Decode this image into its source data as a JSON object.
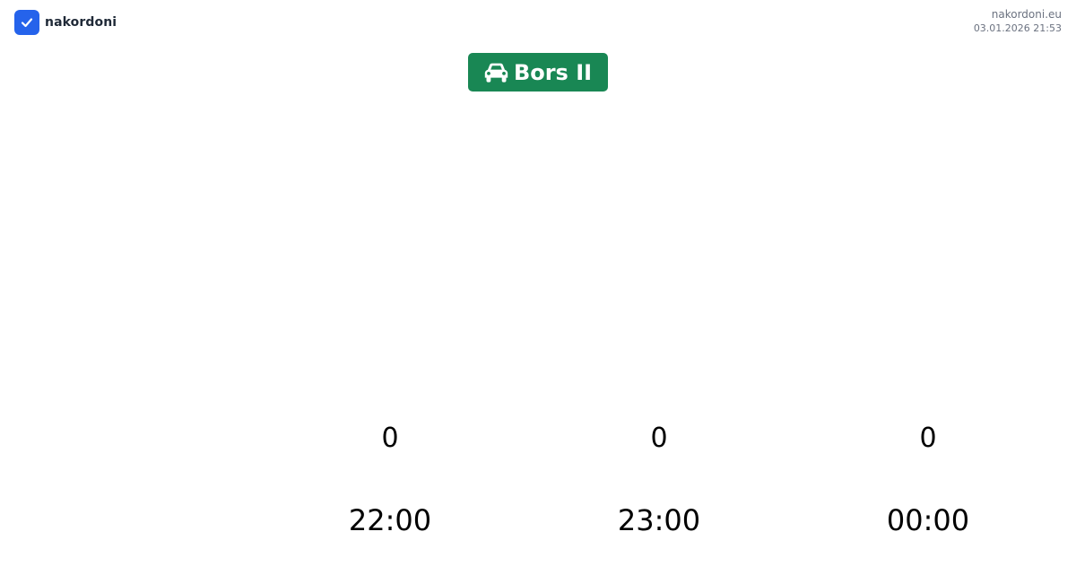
{
  "brand": {
    "name": "nakordoni",
    "logo_icon": "check-icon",
    "logo_color": "#2563eb"
  },
  "meta": {
    "site": "nakordoni.eu",
    "timestamp": "03.01.2026 21:53"
  },
  "crossing": {
    "name": "Bors II",
    "icon": "car-icon",
    "badge_color": "#198754"
  },
  "forecast": [
    {
      "value": "0",
      "time": "22:00"
    },
    {
      "value": "0",
      "time": "23:00"
    },
    {
      "value": "0",
      "time": "00:00"
    }
  ]
}
